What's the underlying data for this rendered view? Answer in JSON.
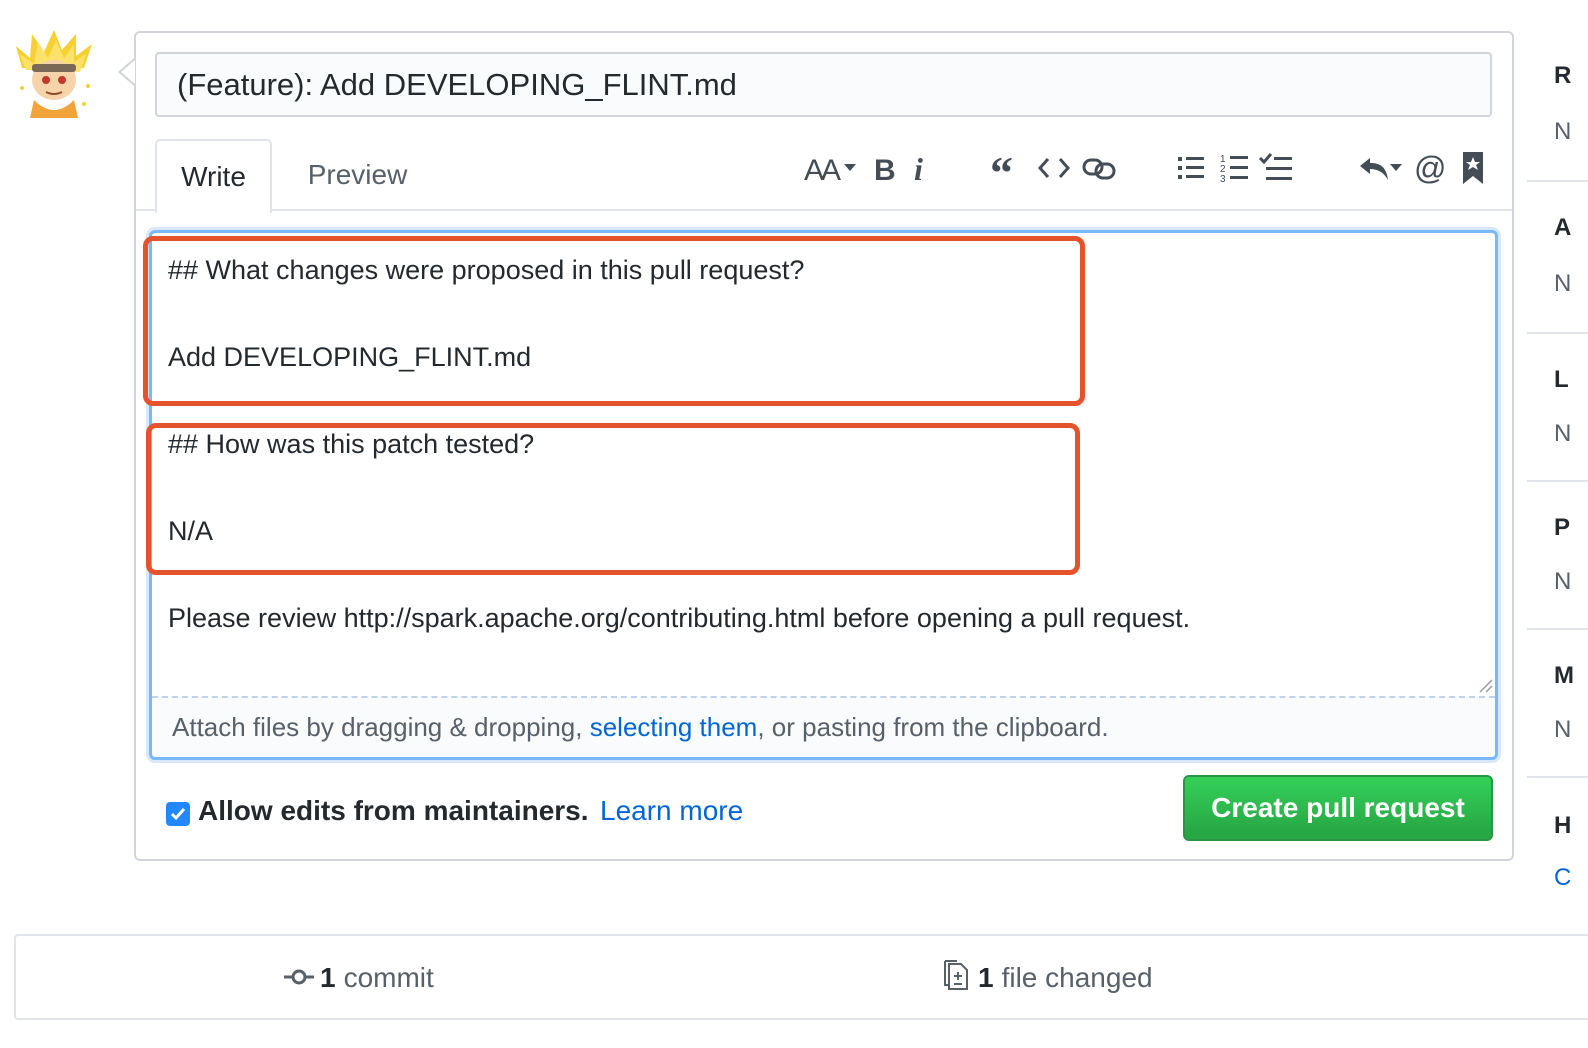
{
  "pull_request": {
    "title_value": "(Feature): Add DEVELOPING_FLINT.md"
  },
  "tabs": {
    "write": "Write",
    "preview": "Preview"
  },
  "toolbar": {
    "icons": [
      "text-size-icon",
      "bold-icon",
      "italic-icon",
      "quote-icon",
      "code-icon",
      "link-icon",
      "unordered-list-icon",
      "ordered-list-icon",
      "task-list-icon",
      "reply-icon",
      "mention-icon",
      "saved-reply-icon"
    ]
  },
  "editor": {
    "lines": [
      "## What changes were proposed in this pull request?",
      "Add DEVELOPING_FLINT.md",
      "## How was this patch tested?",
      "N/A",
      "Please review http://spark.apache.org/contributing.html before opening a pull request."
    ],
    "attach_prefix": "Attach files by dragging & dropping, ",
    "attach_link": "selecting them",
    "attach_suffix": ", or pasting from the clipboard."
  },
  "options": {
    "allow_edits_checked": true,
    "allow_edits_label": "Allow edits from maintainers.",
    "learn_more": "Learn more"
  },
  "actions": {
    "create_pr": "Create pull request"
  },
  "sidebar": {
    "items": [
      {
        "head": "R",
        "value": "N"
      },
      {
        "head": "A",
        "value": "N"
      },
      {
        "head": "L",
        "value": "N"
      },
      {
        "head": "P",
        "value": "N"
      },
      {
        "head": "M",
        "value": "N"
      },
      {
        "head": "H",
        "value": "C"
      }
    ]
  },
  "stats": {
    "commits_count": "1",
    "commits_label": "commit",
    "files_count": "1",
    "files_label": "file changed"
  },
  "colors": {
    "highlight": "#e5532d",
    "primary_button": "#28a745",
    "link": "#0366d6"
  }
}
